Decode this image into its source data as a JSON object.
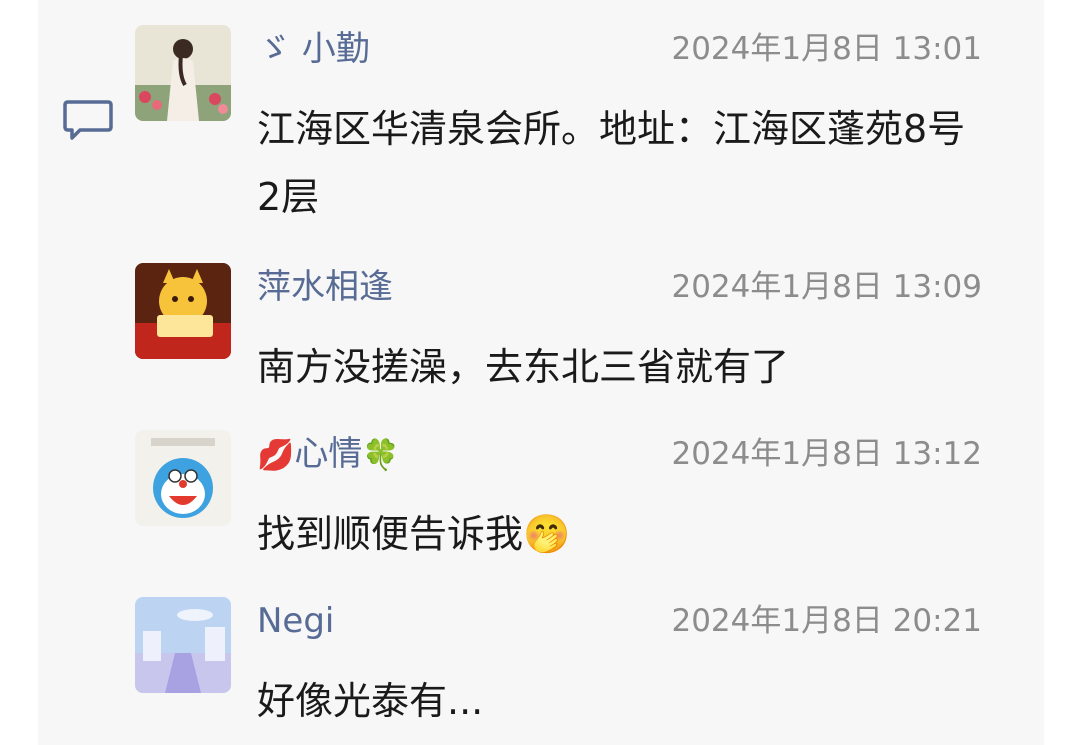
{
  "comments": [
    {
      "name": "ゞ 小勤",
      "time": "2024年1月8日 13:01",
      "text": "江海区华清泉会所。地址：江海区蓬苑8号2层"
    },
    {
      "name": "萍水相逢",
      "time": "2024年1月8日 13:09",
      "text": "南方没搓澡，去东北三省就有了"
    },
    {
      "name_prefix": "💋",
      "name": "心情",
      "name_suffix": "🍀",
      "time": "2024年1月8日 13:12",
      "text": "找到顺便告诉我🤭"
    },
    {
      "name": "Negi",
      "time": "2024年1月8日 20:21",
      "text": "好像光泰有..."
    }
  ],
  "icons": {
    "comment": "comment-bubble-icon"
  },
  "colors": {
    "name": "#576b95",
    "time": "#8c8c8c",
    "panel_bg": "#f7f7f7"
  }
}
